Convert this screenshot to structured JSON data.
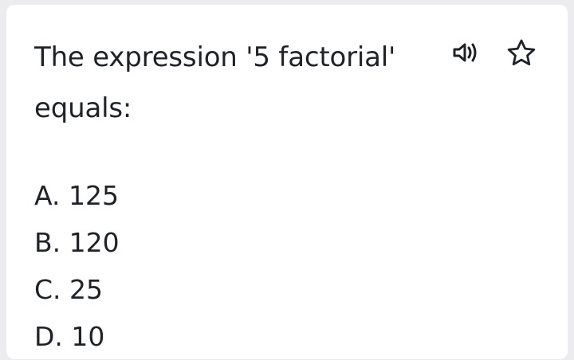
{
  "question": {
    "text": "The expression '5 factorial' equals:"
  },
  "actions": {
    "audio_icon": "speaker-icon",
    "favorite_icon": "star-outline-icon"
  },
  "options": [
    {
      "label": "A. 125"
    },
    {
      "label": "B. 120"
    },
    {
      "label": "C. 25"
    },
    {
      "label": "D. 10"
    }
  ],
  "colors": {
    "text": "#1f2328",
    "card_background": "#ffffff",
    "page_background": "#ececee"
  }
}
